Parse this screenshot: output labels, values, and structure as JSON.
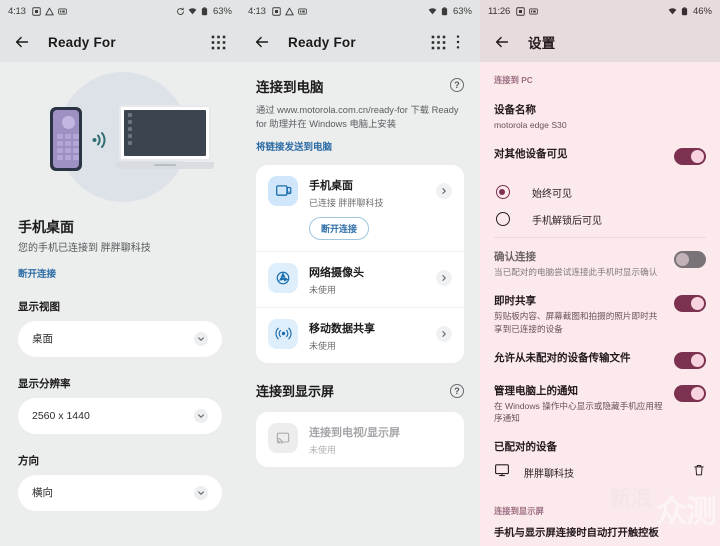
{
  "left": {
    "statusbar": {
      "time": "4:13",
      "battery": "63%"
    },
    "appbar": {
      "title": "Ready For"
    },
    "heading": "手机桌面",
    "subtitle": "您的手机已连接到 胖胖聊科技",
    "disconnect_link": "断开连接",
    "fields": [
      {
        "label": "显示视图",
        "value": "桌面"
      },
      {
        "label": "显示分辨率",
        "value": "2560 x 1440"
      },
      {
        "label": "方向",
        "value": "横向"
      }
    ]
  },
  "middle": {
    "statusbar": {
      "time": "4:13",
      "battery": "63%"
    },
    "appbar": {
      "title": "Ready For"
    },
    "pc_section": {
      "title": "连接到电脑",
      "description": "通过 www.motorola.com.cn/ready-for 下载 Ready for 助理并在 Windows 电脑上安装",
      "send_link": "将链接发送到电脑",
      "items": [
        {
          "title": "手机桌面",
          "subtitle": "已连接 胖胖聊科技",
          "action": "断开连接"
        },
        {
          "title": "网络摄像头",
          "subtitle": "未使用"
        },
        {
          "title": "移动数据共享",
          "subtitle": "未使用"
        }
      ]
    },
    "display_section": {
      "title": "连接到显示屏",
      "items": [
        {
          "title": "连接到电视/显示屏",
          "subtitle": "未使用"
        }
      ]
    }
  },
  "right": {
    "statusbar": {
      "time": "11:26",
      "battery": "46%"
    },
    "appbar": {
      "title": "设置"
    },
    "category_pc": "连接到 PC",
    "device_name": {
      "label": "设备名称",
      "value": "motorola edge S30"
    },
    "visibility": {
      "label": "对其他设备可见",
      "toggle": "on",
      "options": [
        {
          "label": "始终可见",
          "selected": true
        },
        {
          "label": "手机解锁后可见",
          "selected": false
        }
      ]
    },
    "settings": [
      {
        "label": "确认连接",
        "desc": "当已配对的电脑尝试连接此手机时显示确认",
        "toggle": "off"
      },
      {
        "label": "即时共享",
        "desc": "剪贴板内容、屏幕截图和拍摄的照片即时共享到已连接的设备",
        "toggle": "on"
      },
      {
        "label": "允许从未配对的设备传输文件",
        "desc": "",
        "toggle": "on"
      },
      {
        "label": "管理电脑上的通知",
        "desc": "在 Windows 操作中心显示或隐藏手机应用程序通知",
        "toggle": "on"
      }
    ],
    "paired": {
      "label": "已配对的设备",
      "device": "胖胖聊科技"
    },
    "category_display": "连接到显示屏",
    "final_item": "手机与显示屏连接时自动打开触控板"
  },
  "watermark": {
    "left": "新浪",
    "right": "众测"
  },
  "colors": {
    "accent_blue": "#2e6ea6",
    "accent_magenta": "#7d3150",
    "toggle_thumb_on": "#f9d2e0",
    "panel_gray": "#eceded",
    "panel_pink": "#fbe9ec"
  }
}
